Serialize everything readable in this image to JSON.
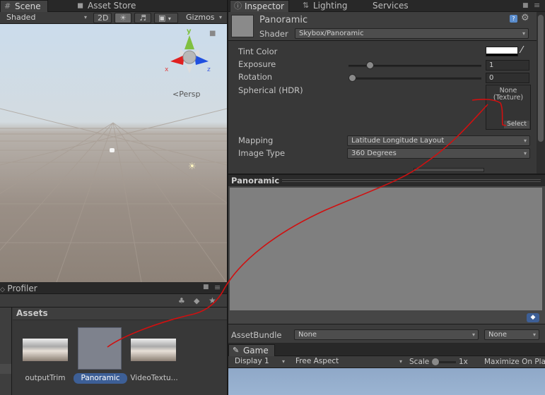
{
  "scene": {
    "tabs": [
      {
        "label": "Scene",
        "icon": "grid-icon"
      },
      {
        "label": "Asset Store",
        "icon": "store-icon"
      }
    ],
    "toolbar": {
      "shading": "Shaded",
      "mode_2d": "2D",
      "gizmos": "Gizmos"
    },
    "gizmo": {
      "y_label": "y",
      "x_label": "x",
      "z_label": "z",
      "persp": "Persp"
    }
  },
  "inspector": {
    "tabs": [
      {
        "label": "Inspector",
        "icon": "info-icon"
      },
      {
        "label": "Lighting",
        "icon": "lighting-icon"
      },
      {
        "label": "Services",
        "icon": ""
      }
    ],
    "material_name": "Panoramic",
    "shader_label": "Shader",
    "shader_value": "Skybox/Panoramic",
    "properties": {
      "tint_color": "Tint Color",
      "exposure": "Exposure",
      "exposure_value": "1",
      "exposure_fraction": 0.14,
      "rotation": "Rotation",
      "rotation_value": "0",
      "rotation_fraction": 0.0,
      "spherical": "Spherical  (HDR)",
      "texture_none": "None",
      "texture_type": "(Texture)",
      "select": "Select",
      "mapping": "Mapping",
      "mapping_value": "Latitude Longitude Layout",
      "image_type": "Image Type",
      "image_type_value": "360 Degrees"
    },
    "preview_title": "Panoramic",
    "assetbundle_label": "AssetBundle",
    "assetbundle_value": "None",
    "assetbundle_variant": "None"
  },
  "profiler": {
    "label": "Profiler"
  },
  "assets": {
    "header": "Assets",
    "items": [
      {
        "label": "outputTrim",
        "selected": false
      },
      {
        "label": "Panoramic",
        "selected": true
      },
      {
        "label": "VideoTextu..."
      }
    ]
  },
  "game": {
    "tab": "Game",
    "display": "Display 1",
    "aspect": "Free Aspect",
    "scale_label": "Scale",
    "scale_value": "1x",
    "maximize": "Maximize On Pla"
  },
  "colors": {
    "annotation_line": "#d01010",
    "selection": "#3d5f96"
  }
}
